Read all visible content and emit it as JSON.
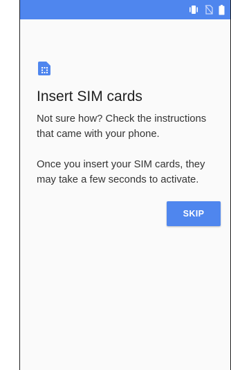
{
  "status_bar": {
    "color": "#4f86ee",
    "icons": [
      "vibrate-icon",
      "no-sim-icon",
      "battery-icon"
    ]
  },
  "setup": {
    "icon": "sim-card-icon",
    "accent_color": "#4f86ee",
    "title": "Insert SIM cards",
    "instructions": "Not sure how? Check the instructions that came with your phone.",
    "activation_note": "Once you insert your SIM cards, they may take a few seconds to activate.",
    "skip_label": "SKIP"
  }
}
